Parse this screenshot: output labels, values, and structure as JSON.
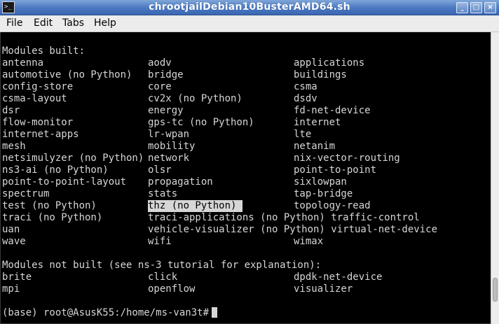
{
  "window": {
    "title": "chrootjailDebian10BusterAMD64.sh",
    "app_icon_glyph": ">_",
    "controls": {
      "minimize": "_",
      "maximize": "□",
      "close": "×"
    }
  },
  "menubar": {
    "items": [
      "File",
      "Edit",
      "Tabs",
      "Help"
    ]
  },
  "terminal": {
    "built_header": "Modules built:",
    "built_rows": [
      [
        "antenna",
        "aodv",
        "applications"
      ],
      [
        "automotive (no Python)",
        "bridge",
        "buildings"
      ],
      [
        "config-store",
        "core",
        "csma"
      ],
      [
        "csma-layout",
        "cv2x (no Python)",
        "dsdv"
      ],
      [
        "dsr",
        "energy",
        "fd-net-device"
      ],
      [
        "flow-monitor",
        "gps-tc (no Python)",
        "internet"
      ],
      [
        "internet-apps",
        "lr-wpan",
        "lte"
      ],
      [
        "mesh",
        "mobility",
        "netanim"
      ],
      [
        "netsimulyzer (no Python)",
        "network",
        "nix-vector-routing"
      ],
      [
        "ns3-ai (no Python)",
        "olsr",
        "point-to-point"
      ],
      [
        "point-to-point-layout",
        "propagation",
        "sixlowpan"
      ],
      [
        "spectrum",
        "stats",
        "tap-bridge"
      ],
      [
        "test (no Python)",
        "thz (no Python) ",
        "topology-read"
      ],
      [
        "traci (no Python)",
        "traci-applications (no Python) traffic-control",
        ""
      ],
      [
        "uan",
        "vehicle-visualizer (no Python) virtual-net-device",
        ""
      ],
      [
        "wave",
        "wifi",
        "wimax"
      ]
    ],
    "not_built_header": "Modules not built (see ns-3 tutorial for explanation):",
    "not_built_rows": [
      [
        "brite",
        "click",
        "dpdk-net-device"
      ],
      [
        "mpi",
        "openflow",
        "visualizer"
      ]
    ],
    "prompt": "(base) root@AsusK55:/home/ms-van3t#",
    "highlighted_cell": "thz (no Python) "
  },
  "scrollbar": {
    "position": 0.93
  }
}
